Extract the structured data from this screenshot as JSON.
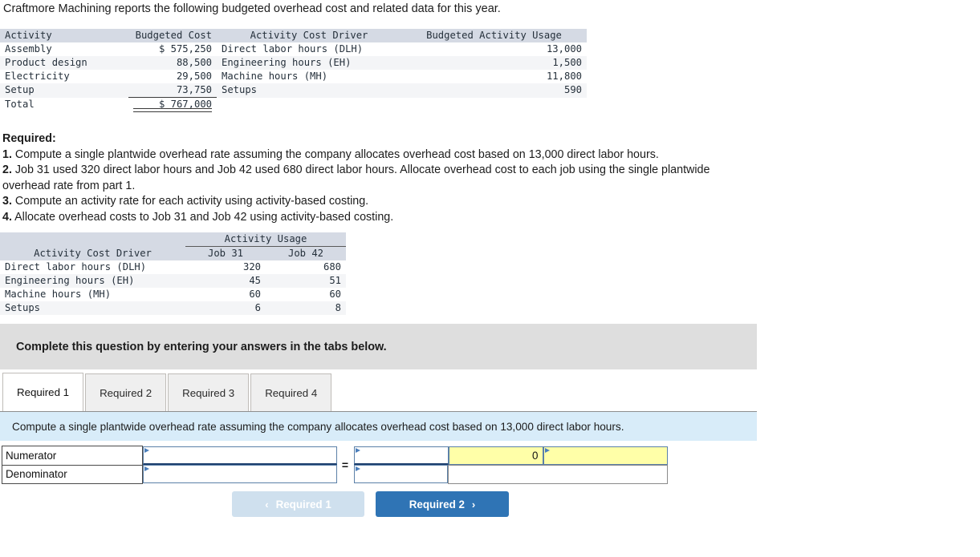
{
  "intro": "Craftmore Machining reports the following budgeted overhead cost and related data for this year.",
  "budget_table": {
    "headers": [
      "Activity",
      "Budgeted Cost",
      "Activity Cost Driver",
      "Budgeted Activity Usage"
    ],
    "rows": [
      {
        "activity": "Assembly",
        "cost": "$ 575,250",
        "driver": "Direct labor hours (DLH)",
        "usage": "13,000"
      },
      {
        "activity": "Product design",
        "cost": "88,500",
        "driver": "Engineering hours (EH)",
        "usage": "1,500"
      },
      {
        "activity": "Electricity",
        "cost": "29,500",
        "driver": "Machine hours (MH)",
        "usage": "11,800"
      },
      {
        "activity": "Setup",
        "cost": "73,750",
        "driver": "Setups",
        "usage": "590"
      }
    ],
    "total_label": "Total",
    "total_cost": "$ 767,000"
  },
  "required": {
    "heading": "Required:",
    "items": [
      {
        "num": "1.",
        "text": " Compute a single plantwide overhead rate assuming the company allocates overhead cost based on 13,000 direct labor hours."
      },
      {
        "num": "2.",
        "text": " Job 31 used 320 direct labor hours and Job 42 used 680 direct labor hours. Allocate overhead cost to each job using the single plantwide overhead rate from part 1."
      },
      {
        "num": "3.",
        "text": " Compute an activity rate for each activity using activity-based costing."
      },
      {
        "num": "4.",
        "text": " Allocate overhead costs to Job 31 and Job 42 using activity-based costing."
      }
    ]
  },
  "usage_table": {
    "span_header": "Activity Usage",
    "headers": [
      "Activity Cost Driver",
      "Job 31",
      "Job 42"
    ],
    "rows": [
      {
        "driver": "Direct labor hours (DLH)",
        "job31": "320",
        "job42": "680"
      },
      {
        "driver": "Engineering hours (EH)",
        "job31": "45",
        "job42": "51"
      },
      {
        "driver": "Machine hours (MH)",
        "job31": "60",
        "job42": "60"
      },
      {
        "driver": "Setups",
        "job31": "6",
        "job42": "8"
      }
    ]
  },
  "grey_banner": "Complete this question by entering your answers in the tabs below.",
  "tabs": [
    {
      "label": "Required 1",
      "active": true
    },
    {
      "label": "Required 2",
      "active": false
    },
    {
      "label": "Required 3",
      "active": false
    },
    {
      "label": "Required 4",
      "active": false
    }
  ],
  "tab_instruction": "Compute a single plantwide overhead rate assuming the company allocates overhead cost based on 13,000 direct labor hours.",
  "answer_form": {
    "numerator_label": "Numerator",
    "denominator_label": "Denominator",
    "equals": "=",
    "numerator_value": "",
    "denominator_value": "",
    "result_num_value": "",
    "result_den_value": "",
    "result_value": "0",
    "result_unit_value": ""
  },
  "nav": {
    "prev_label": "Required 1",
    "next_label": "Required 2",
    "prev_icon": "chevron-left-icon",
    "next_icon": "chevron-right-icon",
    "prev_chevron": "‹",
    "next_chevron": "›"
  },
  "colors": {
    "tab_banner_blue": "#d8ecf9",
    "grey_banner": "#dedede",
    "answer_highlight": "#ffffa8",
    "primary_button": "#2f74b5",
    "disabled_button": "#cfe0ee",
    "table_header": "#d5dae4"
  }
}
